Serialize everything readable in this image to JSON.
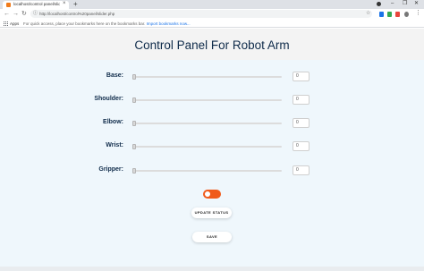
{
  "browser": {
    "tab_title": "localhost/control panel/slider.ph",
    "tab_close": "×",
    "new_tab": "+",
    "window_controls": {
      "minimize": "–",
      "maximize": "❐",
      "close": "✕"
    },
    "nav": {
      "back": "←",
      "forward": "→",
      "reload": "↻"
    },
    "url": "http://localhost/control%20panel/slider.php",
    "url_icon": "ⓘ",
    "star": "☆",
    "menu": "⋮",
    "bookmarks": {
      "apps_label": "Apps",
      "hint_text": "For quick access, place your bookmarks here on the bookmarks bar.",
      "import_link": "Import bookmarks now..."
    },
    "extension_colors": [
      "#1a73e8",
      "#34a853",
      "#e8453c",
      "#777777"
    ]
  },
  "page": {
    "title": "Control Panel For Robot Arm",
    "joints": [
      {
        "label": "Base:",
        "value": "0"
      },
      {
        "label": "Shoulder:",
        "value": "0"
      },
      {
        "label": "Elbow:",
        "value": "0"
      },
      {
        "label": "Wrist:",
        "value": "0"
      },
      {
        "label": "Gripper:",
        "value": "0"
      }
    ],
    "toggle": {
      "state": "on",
      "color": "#f05a1a"
    },
    "update_button": "UPDATE STATUS",
    "save_button": "SAVE"
  }
}
